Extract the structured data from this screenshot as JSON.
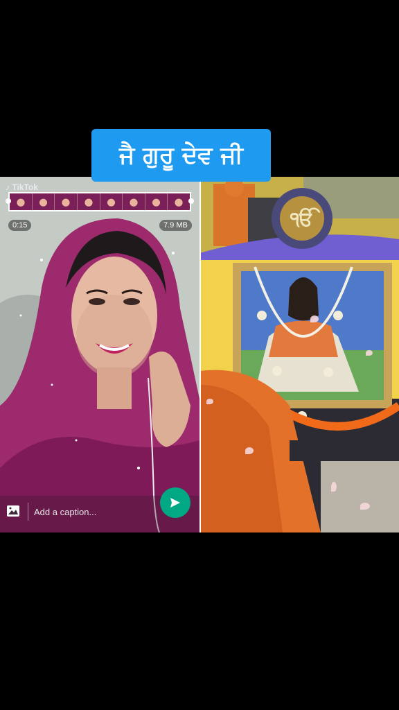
{
  "banner": {
    "title": "ਜੈ ਗੁਰੂ ਦੇਵ ਜੀ"
  },
  "editor": {
    "watermark": "TikTok",
    "duration": "0:15",
    "file_size": "7.9 MB",
    "caption_placeholder": "Add a caption...",
    "thumbnail_count": 8
  },
  "colors": {
    "banner_bg": "#1e9bf0",
    "send_button": "#00a884"
  },
  "icons": {
    "gallery": "image-icon",
    "send": "send-icon"
  }
}
